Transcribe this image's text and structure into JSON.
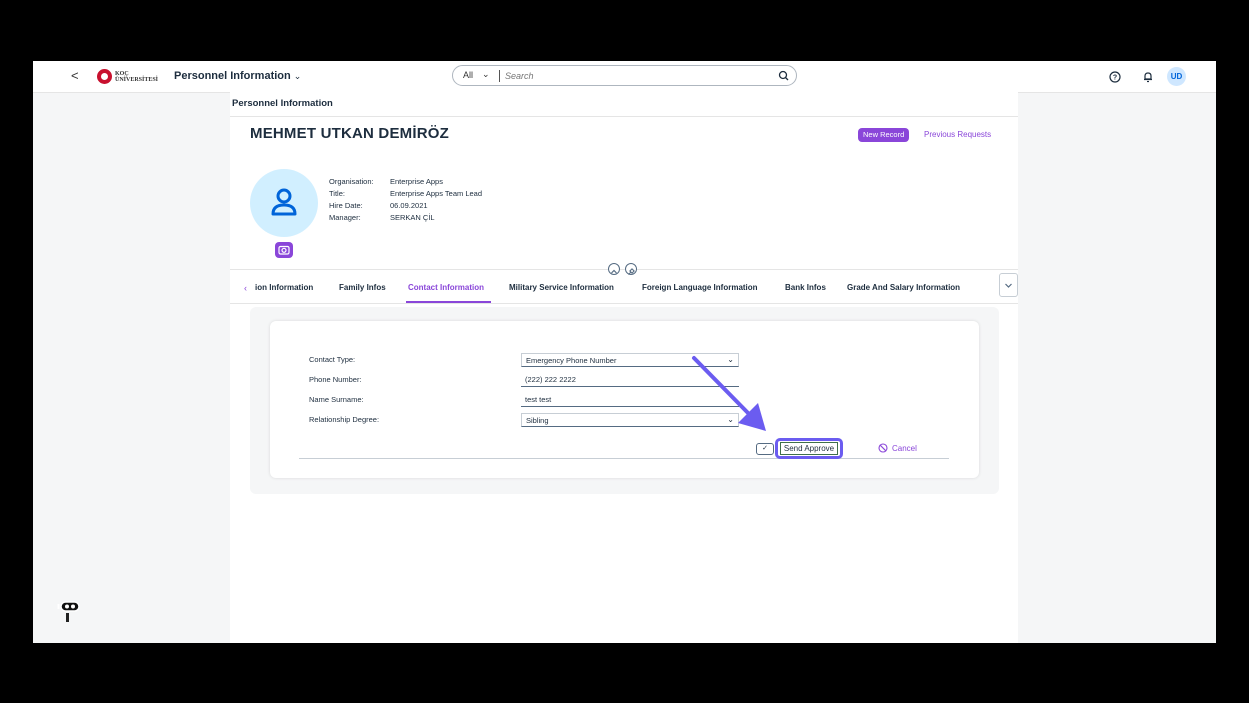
{
  "shell": {
    "back_glyph": "<",
    "brand_line1": "KOÇ",
    "brand_line2": "ÜNİVERSİTESİ",
    "app_title": "Personnel Information",
    "search_scope": "All",
    "search_placeholder": "Search",
    "avatar_initials": "UD"
  },
  "page": {
    "title": "Personnel Information",
    "employee_name": "MEHMET UTKAN DEMİRÖZ",
    "new_record_label": "New Record",
    "previous_requests_label": "Previous Requests"
  },
  "employee_info": [
    {
      "label": "Organisation:",
      "value": "Enterprise Apps"
    },
    {
      "label": "Title:",
      "value": "Enterprise Apps Team Lead"
    },
    {
      "label": "Hire Date:",
      "value": "06.09.2021"
    },
    {
      "label": "Manager:",
      "value": "SERKAN ÇİL"
    }
  ],
  "tabs": [
    {
      "label": "ion Information"
    },
    {
      "label": "Family Infos"
    },
    {
      "label": "Contact Information",
      "active": true
    },
    {
      "label": "Military Service Information"
    },
    {
      "label": "Foreign Language Information"
    },
    {
      "label": "Bank Infos"
    },
    {
      "label": "Grade And Salary Information"
    }
  ],
  "form": {
    "contact_type_label": "Contact Type:",
    "contact_type_value": "Emergency Phone Number",
    "phone_label": "Phone Number:",
    "phone_value": "(222) 222 2222",
    "name_label": "Name Surname:",
    "name_value": "test test",
    "relationship_label": "Relationship Degree:",
    "relationship_value": "Sibling",
    "send_label": "Send Approve",
    "cancel_label": "Cancel"
  },
  "colors": {
    "accent": "#8a46d9",
    "highlight": "#6b5cf0",
    "avatar_bg": "#d1efff"
  }
}
